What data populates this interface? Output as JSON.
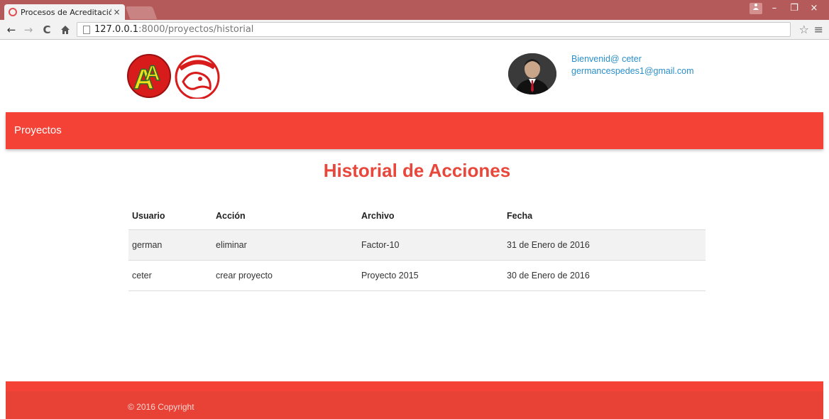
{
  "browser": {
    "tab_title": "Procesos de Acreditación",
    "tab_close": "×",
    "url_host": "127.0.0.1",
    "url_path": ":8000/proyectos/historial",
    "icons": {
      "back": "back-arrow-icon",
      "forward": "forward-arrow-icon",
      "reload": "reload-icon",
      "home": "home-icon",
      "bookmark": "star-icon",
      "menu": "hamburger-menu-icon"
    },
    "window_controls": {
      "minimize": "–",
      "restore": "❐",
      "close": "×"
    }
  },
  "header": {
    "greeting": "Bienvenid@ ceter",
    "email": "germancespedes1@gmail.com",
    "link_color": "#2a8fc9"
  },
  "nav": {
    "items": [
      {
        "label": "Proyectos"
      }
    ],
    "color": "#f44336"
  },
  "main": {
    "title": "Historial de Acciones",
    "title_color": "#e8473b",
    "table": {
      "columns": [
        "Usuario",
        "Acción",
        "Archivo",
        "Fecha"
      ],
      "rows": [
        [
          "german",
          "eliminar",
          "Factor-10",
          "31 de Enero de 2016"
        ],
        [
          "ceter",
          "crear proyecto",
          "Proyecto 2015",
          "30 de Enero de 2016"
        ]
      ]
    }
  },
  "footer": {
    "copyright": "© 2016 Copyright",
    "color": "#e84135"
  }
}
